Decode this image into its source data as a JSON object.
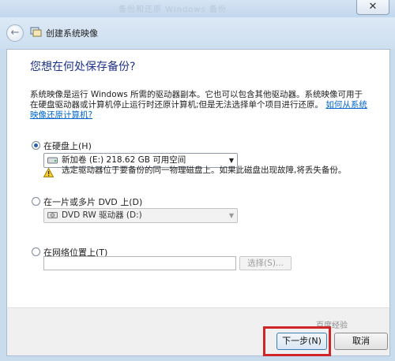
{
  "window": {
    "faded_title": "备份和还原 Windows 备份",
    "close_label": "✕",
    "wizard_title": "创建系统映像"
  },
  "content": {
    "heading": "您想在何处保存备份?",
    "description": "系统映像是运行 Windows 所需的驱动器副本。它也可以包含其他驱动器。系统映像可用于在硬盘驱动器或计算机停止运行时还原计算机;但是无法选择单个项目进行还原。",
    "help_link": "如何从系统映像还原计算机?"
  },
  "options": {
    "hard_disk": {
      "label": "在硬盘上(H)",
      "selected": true,
      "combo_value": "新加卷 (E:)  218.62 GB 可用空间",
      "warning": "选定驱动器位于要备份的同一物理磁盘上。如果此磁盘出现故障,将丢失备份。"
    },
    "dvd": {
      "label": "在一片或多片 DVD 上(D)",
      "selected": false,
      "combo_value": "DVD RW 驱动器 (D:)"
    },
    "network": {
      "label": "在网络位置上(T)",
      "selected": false,
      "path_value": "",
      "browse_label": "选择(S)..."
    }
  },
  "footer": {
    "next_label": "下一步(N)",
    "cancel_label": "取消",
    "watermark": "百度经验"
  },
  "colors": {
    "heading": "#1e3287",
    "link": "#0066cc",
    "highlight": "#d0262a",
    "chrome": "#c9dcee"
  }
}
